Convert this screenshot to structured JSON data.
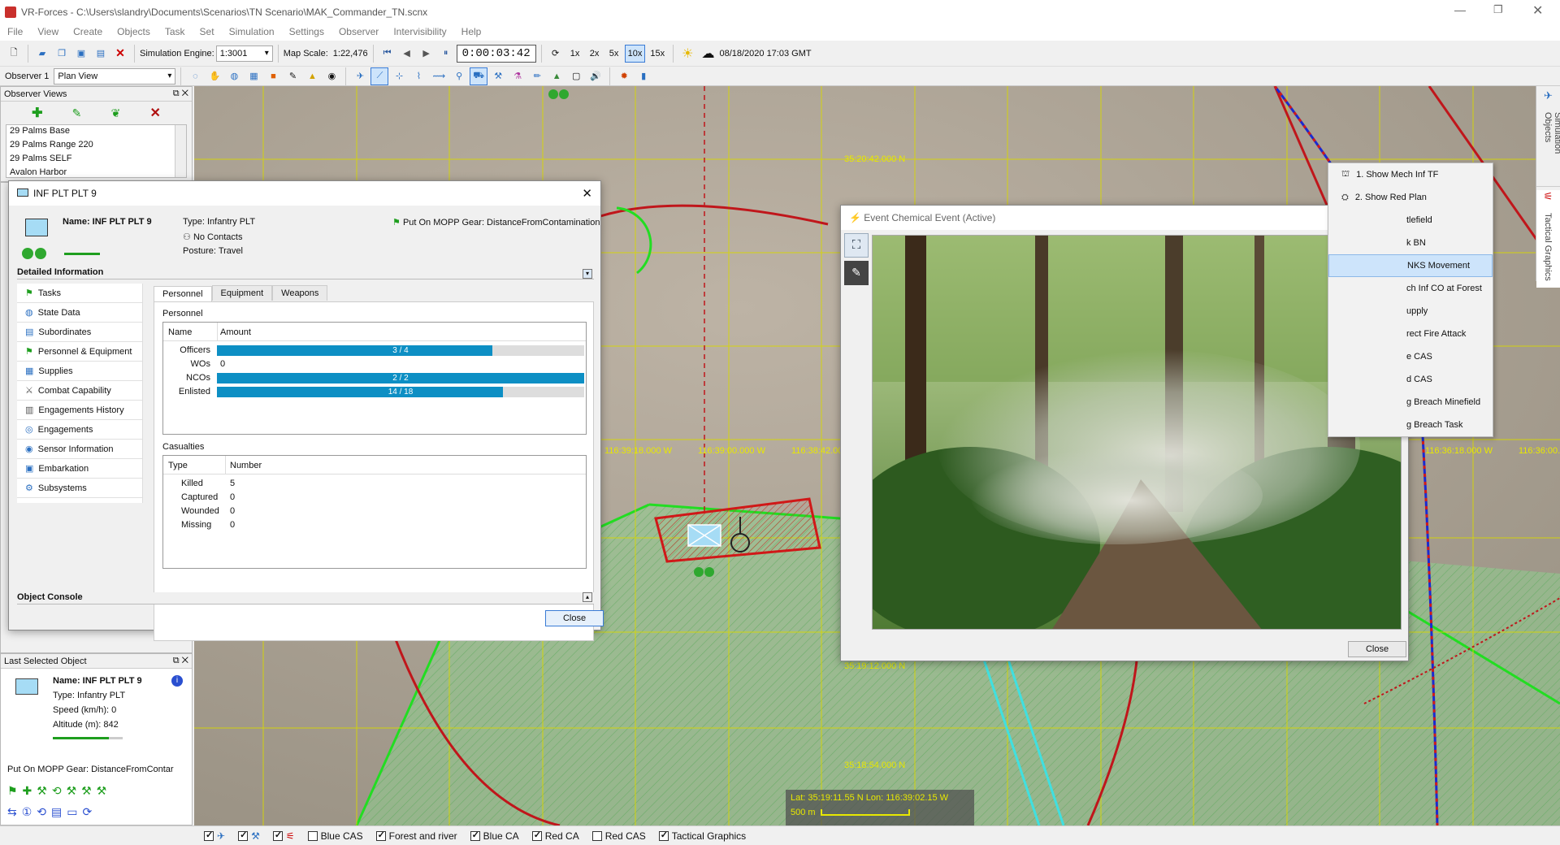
{
  "window": {
    "title": "VR-Forces - C:\\Users\\slandry\\Documents\\Scenarios\\TN Scenario\\MAK_Commander_TN.scnx"
  },
  "menu": [
    "File",
    "View",
    "Create",
    "Objects",
    "Task",
    "Set",
    "Simulation",
    "Settings",
    "Observer",
    "Intervisibility",
    "Help"
  ],
  "toolbar": {
    "sim_engine_label": "Simulation Engine:",
    "sim_engine_value": "1:3001",
    "map_scale_label": "Map Scale:",
    "map_scale_value": "1:22,476",
    "clock": "0:00:03:42",
    "speeds": [
      "1x",
      "2x",
      "5x",
      "10x",
      "15x"
    ],
    "active_speed": "10x",
    "datetime": "08/18/2020 17:03 GMT"
  },
  "toolbar2": {
    "observer": "Observer 1",
    "view": "Plan View"
  },
  "observer_views": {
    "title": "Observer Views",
    "items": [
      "29 Palms Base",
      "29 Palms Range 220",
      "29 Palms SELF",
      "Avalon Harbor"
    ]
  },
  "last_selected": {
    "title": "Last Selected Object",
    "name": "Name: INF PLT PLT 9",
    "type": "Type: Infantry PLT",
    "speed": "Speed (km/h): 0",
    "altitude": "Altitude (m): 842",
    "task": "Put On MOPP Gear: DistanceFromContar"
  },
  "inf_dialog": {
    "title": "INF PLT PLT 9",
    "name": "Name: INF PLT PLT 9",
    "type": "Type: Infantry PLT",
    "contacts": "No Contacts",
    "posture": "Posture: Travel",
    "task": "Put On MOPP Gear: DistanceFromContamination",
    "detailed": "Detailed Information",
    "nav": [
      "Tasks",
      "State Data",
      "Subordinates",
      "Personnel & Equipment",
      "Supplies",
      "Combat Capability",
      "Engagements History",
      "Engagements",
      "Sensor Information",
      "Embarkation",
      "Subsystems"
    ],
    "tabs": [
      "Personnel",
      "Equipment",
      "Weapons"
    ],
    "personnel_label": "Personnel",
    "personnel_headers": [
      "Name",
      "Amount"
    ],
    "personnel": [
      {
        "name": "Officers",
        "text": "3 / 4",
        "frac": 0.75
      },
      {
        "name": "WOs",
        "text": "0",
        "frac": 0
      },
      {
        "name": "NCOs",
        "text": "2 / 2",
        "frac": 1.0
      },
      {
        "name": "Enlisted",
        "text": "14 / 18",
        "frac": 0.778
      }
    ],
    "casualties_label": "Casualties",
    "casualty_headers": [
      "Type",
      "Number"
    ],
    "casualties": [
      {
        "type": "Killed",
        "num": "5"
      },
      {
        "type": "Captured",
        "num": "0"
      },
      {
        "type": "Wounded",
        "num": "0"
      },
      {
        "type": "Missing",
        "num": "0"
      }
    ],
    "console": "Object Console",
    "close": "Close"
  },
  "event_dialog": {
    "title": "Event Chemical Event (Active)",
    "close": "Close"
  },
  "context_menu": [
    "1. Show Mech Inf TF",
    "2. Show Red Plan",
    "tlefield",
    "k BN",
    "NKS Movement",
    "ch Inf CO at Forest",
    "upply",
    "rect Fire Attack",
    "e CAS",
    "d CAS",
    "g Breach Minefield",
    "g Breach Task"
  ],
  "side_tabs": [
    "Simulation Objects",
    "Tactical Graphics"
  ],
  "map": {
    "labels": [
      "35:20:42.000 N",
      "116:39:18.000 W",
      "116:39:00.000 W",
      "116:38:42.000 W",
      "116:36:18.000 W",
      "116:36:00.",
      "35:19:12.000 N",
      "35:18:54.000 N"
    ],
    "latlon": "Lat: 35:19:11.55 N Lon: 116:39:02.15 W",
    "scale": "500 m"
  },
  "bottom": [
    {
      "label": "Blue CAS",
      "checked": false
    },
    {
      "label": "Forest and river",
      "checked": true
    },
    {
      "label": "Blue CA",
      "checked": true
    },
    {
      "label": "Red CA",
      "checked": true
    },
    {
      "label": "Red CAS",
      "checked": false
    },
    {
      "label": "Tactical Graphics",
      "checked": true
    }
  ]
}
